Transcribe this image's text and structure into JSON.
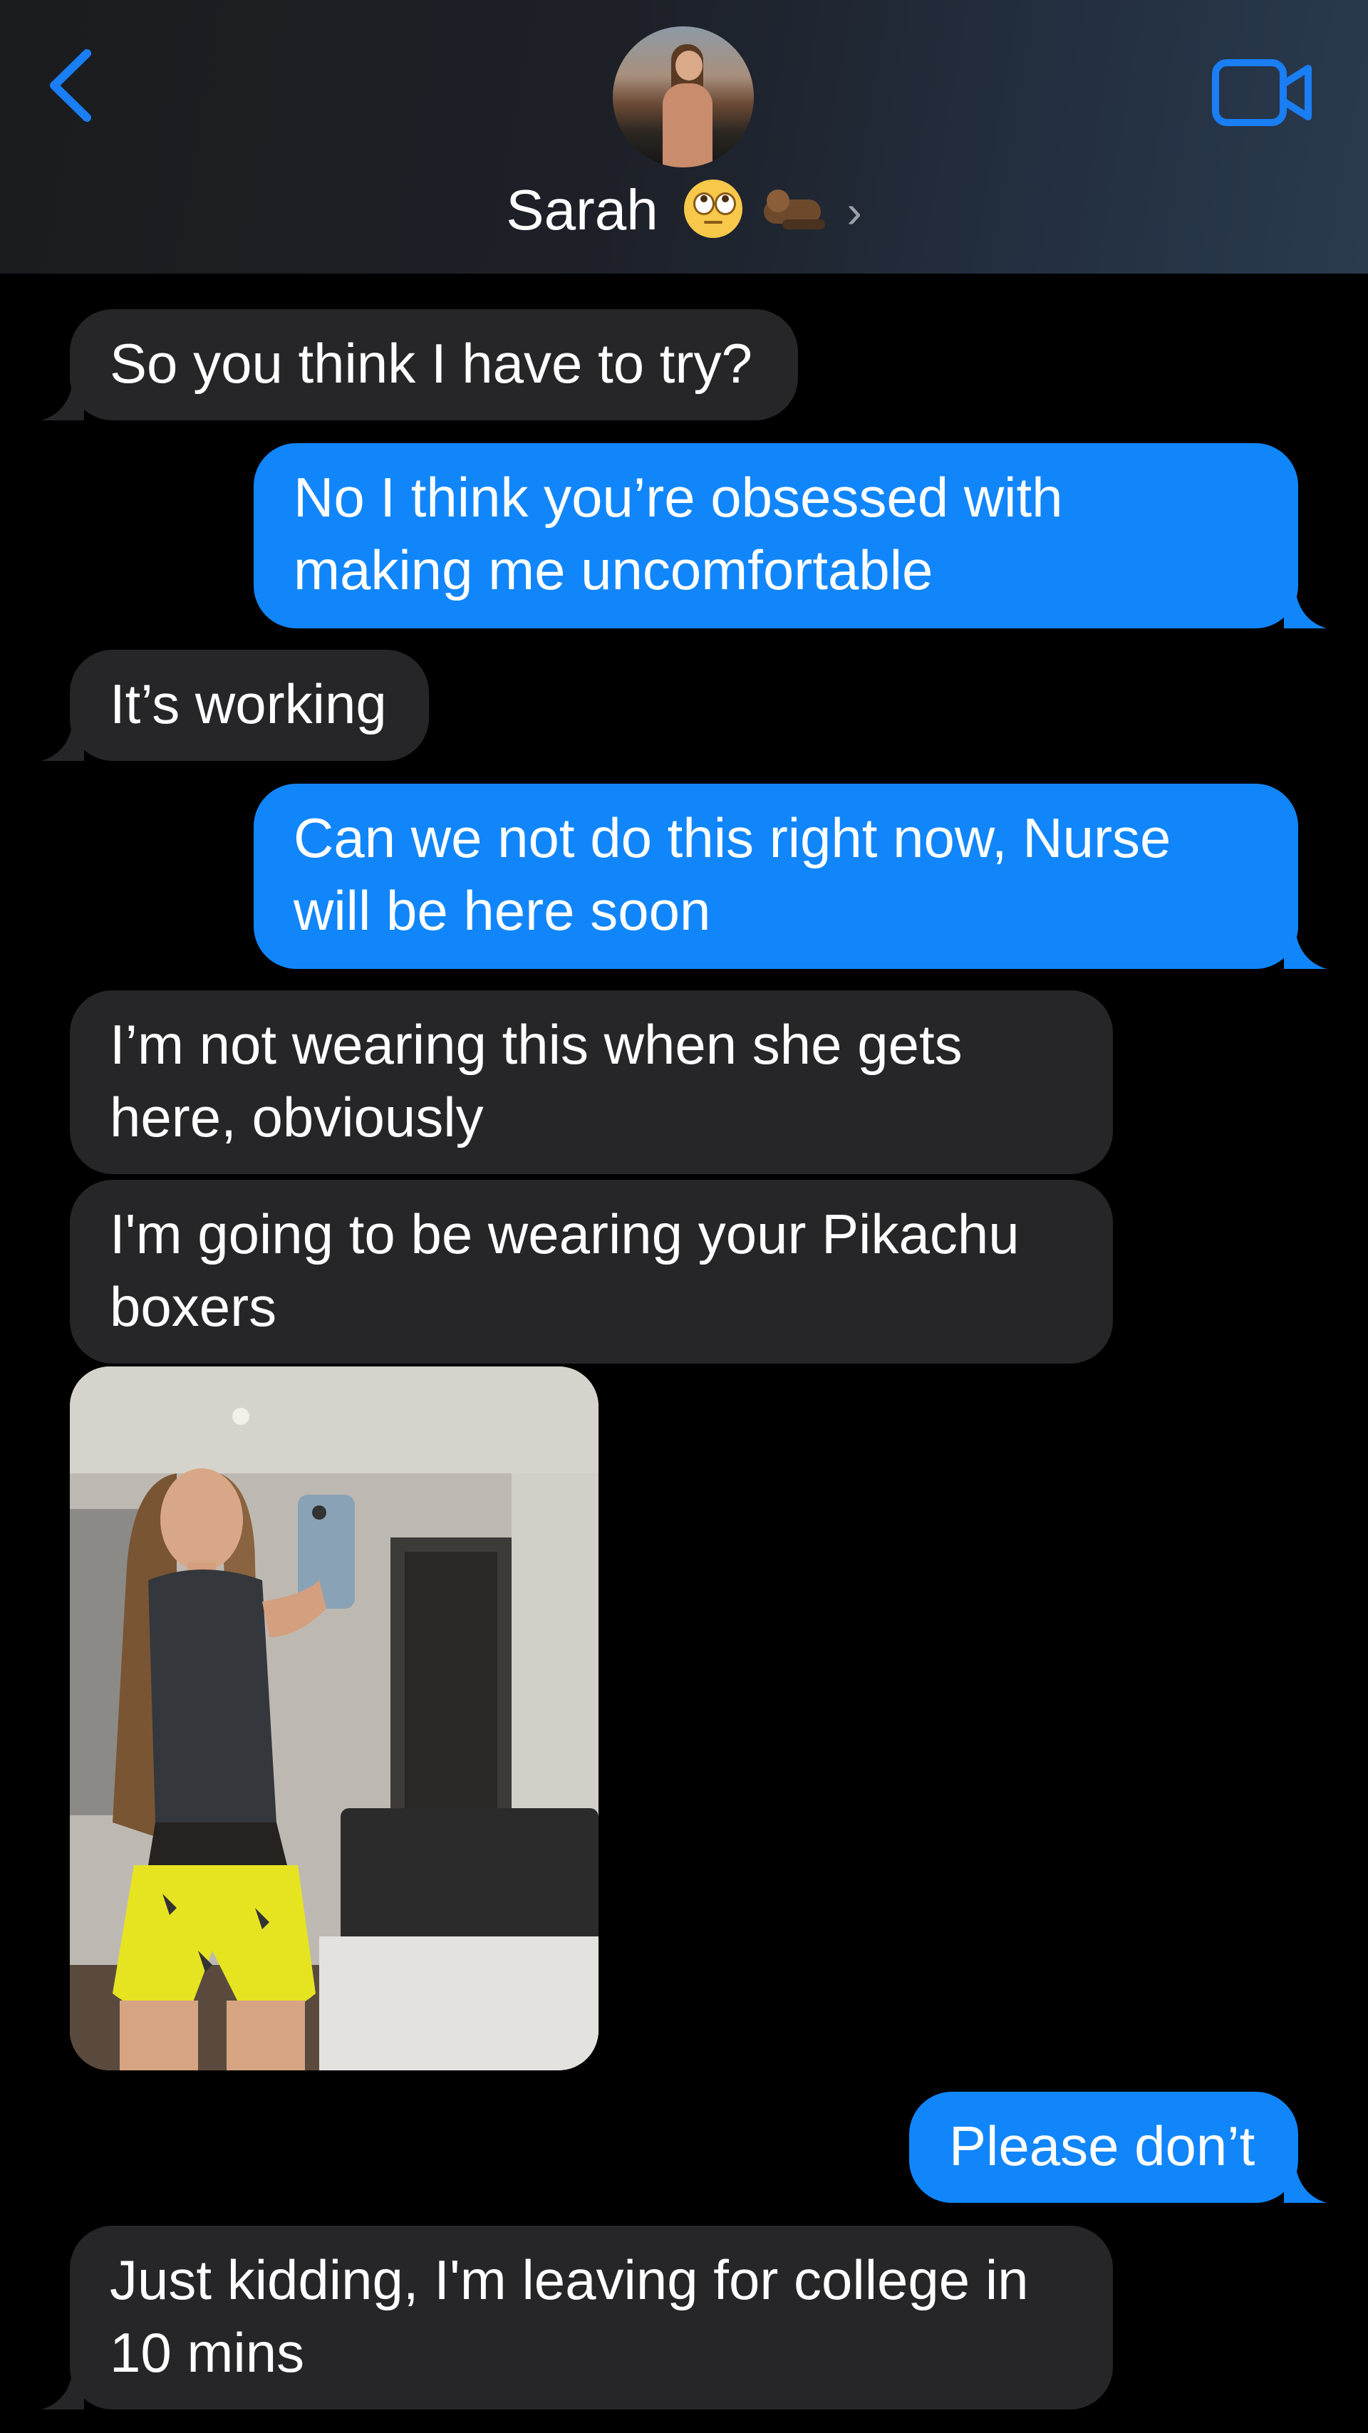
{
  "header": {
    "contact_name": "Sarah",
    "emoji_1": "face-with-rolling-eyes",
    "emoji_2": "otter"
  },
  "messages": [
    {
      "direction": "received",
      "text": "So you think I have to try?"
    },
    {
      "direction": "sent",
      "lines": [
        "No I think you’re obsessed with",
        "making me uncomfortable"
      ]
    },
    {
      "direction": "received",
      "text": "It’s working"
    },
    {
      "direction": "sent",
      "lines": [
        "Can we not do this right now, Nurse",
        "will be here soon"
      ]
    },
    {
      "direction": "received",
      "lines": [
        "I’m not wearing this when she gets",
        "here, obviously"
      ]
    },
    {
      "direction": "received",
      "lines": [
        "I'm going to be wearing your Pikachu",
        "boxers"
      ]
    },
    {
      "direction": "received",
      "type": "photo",
      "description": "mirror-selfie"
    },
    {
      "direction": "sent",
      "text": "Please don’t"
    },
    {
      "direction": "received",
      "lines": [
        "Just kidding, I'm leaving for college in",
        "10 mins"
      ]
    }
  ],
  "colors": {
    "sent_bubble": "#1186fb",
    "received_bubble": "#262628",
    "accent_icon": "#1a7ef4",
    "background": "#000000"
  },
  "icons": [
    "back-chevron-icon",
    "video-call-icon",
    "chevron-right-icon"
  ]
}
